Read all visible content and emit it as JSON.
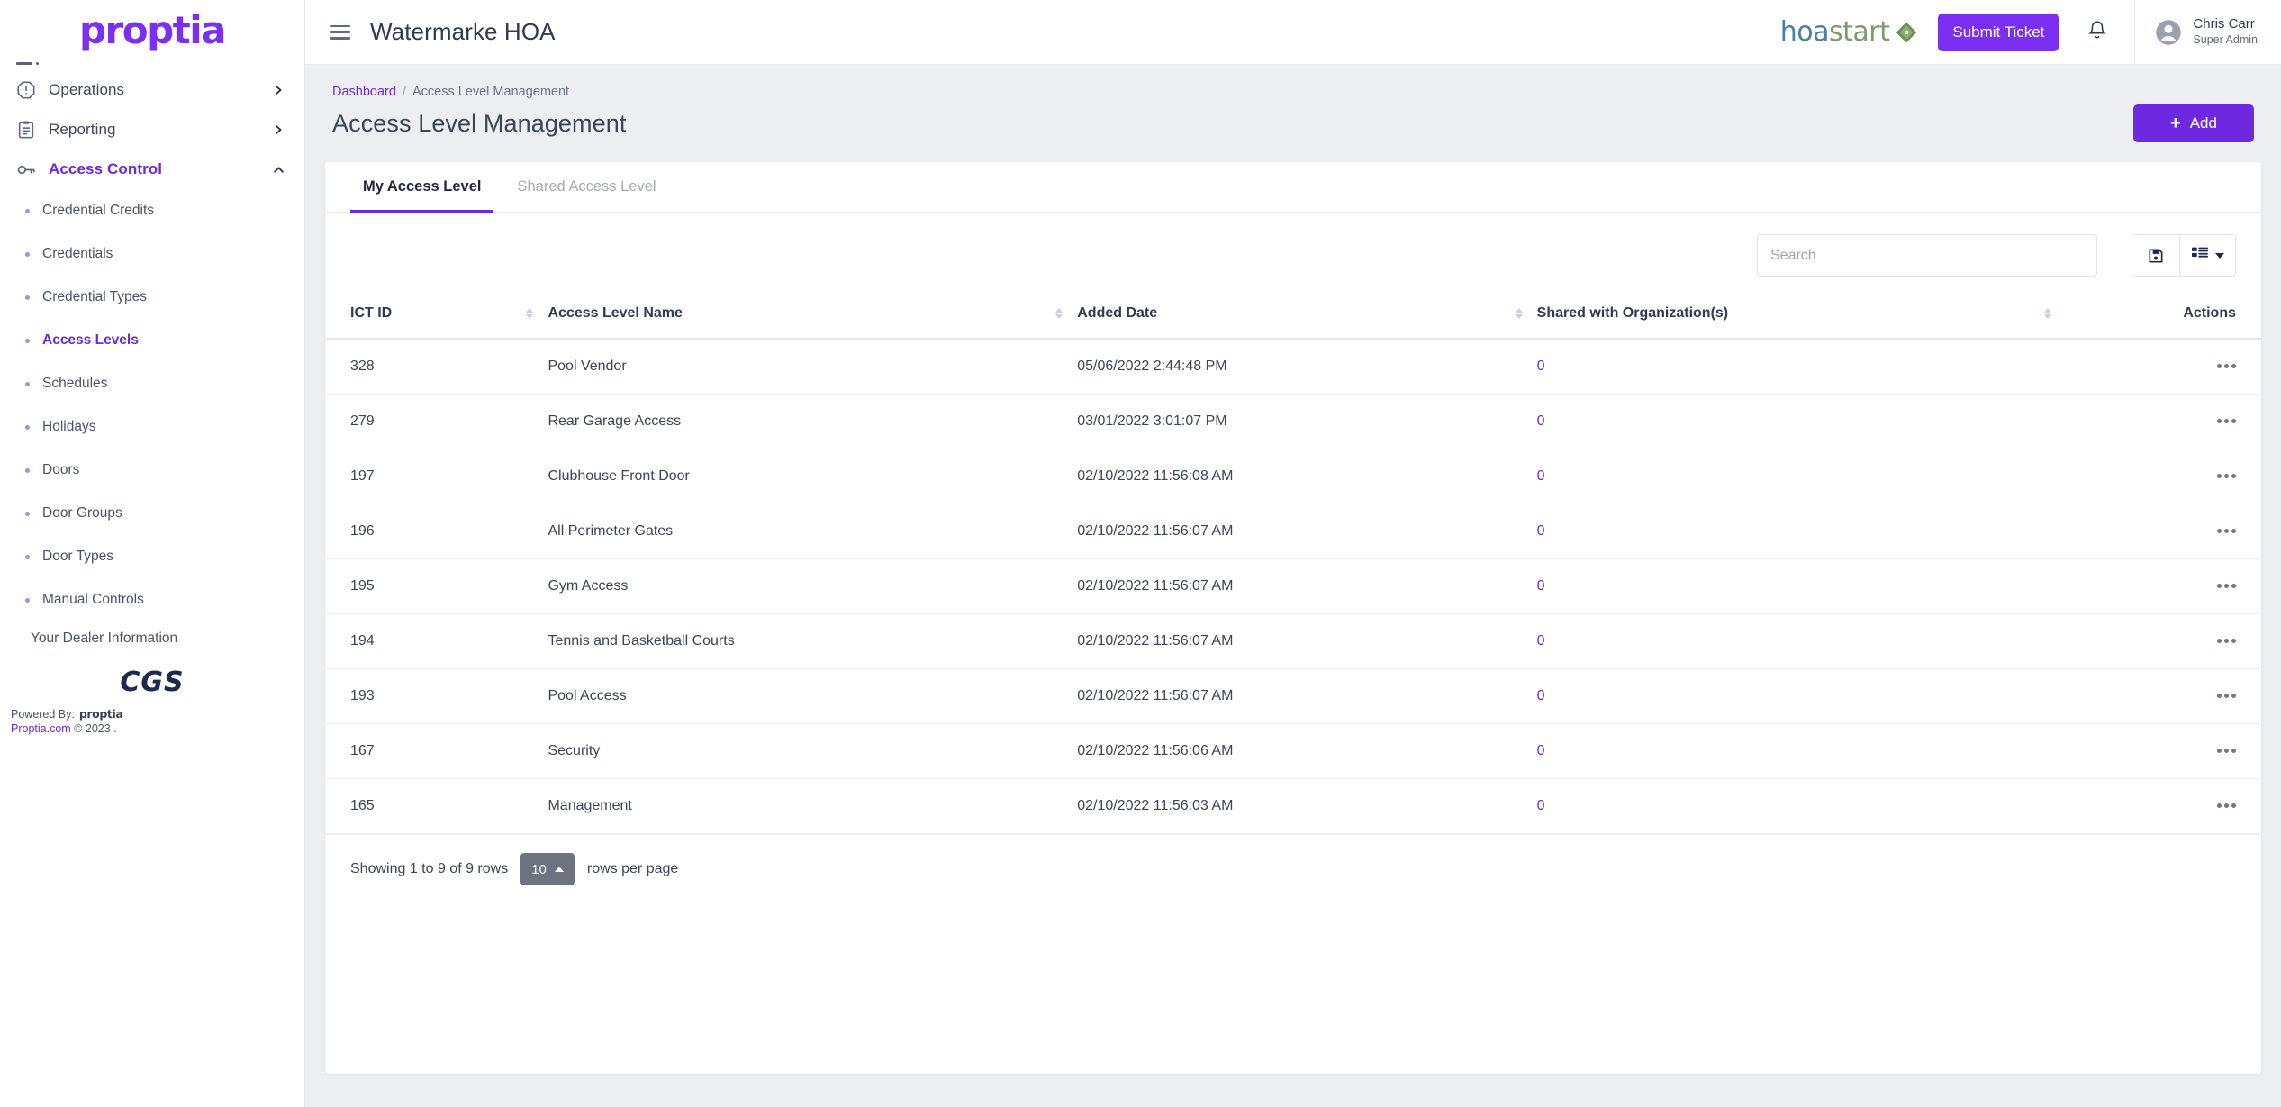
{
  "brand": {
    "logo_text": "proptia"
  },
  "sidebar": {
    "groups": [
      {
        "label": "Operations",
        "icon": "alert-octagon-icon",
        "expanded": false,
        "active": false
      },
      {
        "label": "Reporting",
        "icon": "clipboard-icon",
        "expanded": false,
        "active": false
      },
      {
        "label": "Access Control",
        "icon": "key-icon",
        "expanded": true,
        "active": true
      }
    ],
    "sub_items": [
      {
        "label": "Credential Credits",
        "active": false
      },
      {
        "label": "Credentials",
        "active": false
      },
      {
        "label": "Credential Types",
        "active": false
      },
      {
        "label": "Access Levels",
        "active": true
      },
      {
        "label": "Schedules",
        "active": false
      },
      {
        "label": "Holidays",
        "active": false
      },
      {
        "label": "Doors",
        "active": false
      },
      {
        "label": "Door Groups",
        "active": false
      },
      {
        "label": "Door Types",
        "active": false
      },
      {
        "label": "Manual Controls",
        "active": false
      }
    ],
    "dealer_info_label": "Your Dealer Information",
    "dealer_logo_text": "CGS",
    "powered_by_label": "Powered By:",
    "powered_by_brand": "proptia",
    "copyright_link": "Proptia.com",
    "copyright_text": "© 2023 ."
  },
  "topbar": {
    "menu_icon": "hamburger-icon",
    "title": "Watermarke HOA",
    "partner_logo": {
      "part1": "hoa",
      "part2": "start",
      "badge_icon": "house-diamond-icon"
    },
    "submit_ticket_label": "Submit Ticket",
    "notifications_icon": "bell-icon",
    "user": {
      "name": "Chris Carr",
      "role": "Super Admin",
      "avatar_icon": "user-circle-icon"
    }
  },
  "page": {
    "breadcrumb": {
      "root": "Dashboard",
      "separator": "/",
      "current": "Access Level Management"
    },
    "title": "Access Level Management",
    "add_button": {
      "label": "Add",
      "icon": "plus-icon"
    }
  },
  "tabs": [
    {
      "label": "My Access Level",
      "active": true
    },
    {
      "label": "Shared Access Level",
      "active": false
    }
  ],
  "toolbar": {
    "search_placeholder": "Search",
    "search_value": "",
    "save_icon": "save-icon",
    "columns_icon": "table-columns-icon",
    "columns_caret_icon": "chevron-down-icon"
  },
  "table": {
    "columns": [
      {
        "key": "ict_id",
        "label": "ICT ID",
        "sortable": true
      },
      {
        "key": "name",
        "label": "Access Level Name",
        "sortable": true
      },
      {
        "key": "added_date",
        "label": "Added Date",
        "sortable": true
      },
      {
        "key": "shared",
        "label": "Shared with Organization(s)",
        "sortable": true
      },
      {
        "key": "actions",
        "label": "Actions",
        "sortable": false
      }
    ],
    "rows": [
      {
        "ict_id": "328",
        "name": "Pool Vendor",
        "added_date": "05/06/2022 2:44:48 PM",
        "shared": "0"
      },
      {
        "ict_id": "279",
        "name": "Rear Garage Access",
        "added_date": "03/01/2022 3:01:07 PM",
        "shared": "0"
      },
      {
        "ict_id": "197",
        "name": "Clubhouse Front Door",
        "added_date": "02/10/2022 11:56:08 AM",
        "shared": "0"
      },
      {
        "ict_id": "196",
        "name": "All Perimeter Gates",
        "added_date": "02/10/2022 11:56:07 AM",
        "shared": "0"
      },
      {
        "ict_id": "195",
        "name": "Gym Access",
        "added_date": "02/10/2022 11:56:07 AM",
        "shared": "0"
      },
      {
        "ict_id": "194",
        "name": "Tennis and Basketball Courts",
        "added_date": "02/10/2022 11:56:07 AM",
        "shared": "0"
      },
      {
        "ict_id": "193",
        "name": "Pool Access",
        "added_date": "02/10/2022 11:56:07 AM",
        "shared": "0"
      },
      {
        "ict_id": "167",
        "name": "Security",
        "added_date": "02/10/2022 11:56:06 AM",
        "shared": "0"
      },
      {
        "ict_id": "165",
        "name": "Management",
        "added_date": "02/10/2022 11:56:03 AM",
        "shared": "0"
      }
    ],
    "row_action_icon": "ellipsis-icon"
  },
  "pagination": {
    "showing_text": "Showing 1 to 9 of 9 rows",
    "rows_per_page_value": "10",
    "rows_per_page_label": "rows per page",
    "caret_icon": "caret-up-icon"
  },
  "colors": {
    "accent": "#6D28E0",
    "brand": "#7B2FF2",
    "page_bg": "#eceef2",
    "text": "#3a4558"
  }
}
